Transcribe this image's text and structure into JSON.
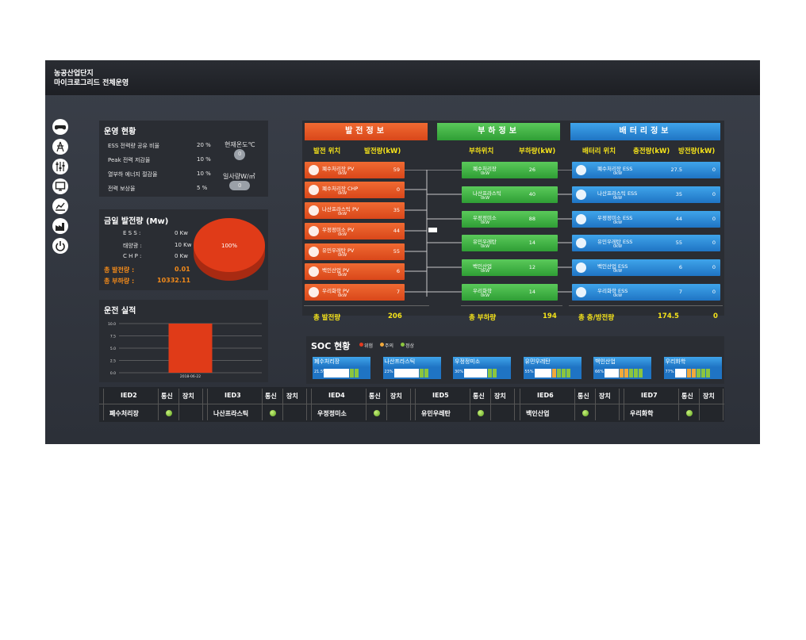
{
  "header": {
    "line1": "농공산업단지",
    "line2": "마이크로그리드 전체운영"
  },
  "sidebar_icons": [
    "gamepad-icon",
    "power-line-icon",
    "sliders-icon",
    "monitor-icon",
    "line-chart-icon",
    "factory-icon",
    "power-icon"
  ],
  "ops": {
    "title": "운영 현황",
    "rows": [
      {
        "label": "ESS 전력량 공유 비율",
        "value": "20 %"
      },
      {
        "label": "Peak 전력 저감율",
        "value": "10 %"
      },
      {
        "label": "열부하 에너지 절감율",
        "value": "10 %"
      },
      {
        "label": "전력 보상율",
        "value": "5 %"
      }
    ],
    "temp_label": "현재온도℃",
    "temp_value": "0",
    "sun_label": "일사량W/㎡",
    "sun_value": "0"
  },
  "today": {
    "title": "금일 발전량 (Mw)",
    "rows": [
      {
        "label": "E S S :",
        "value": "0 Kw"
      },
      {
        "label": "태양광 :",
        "value": "10 Kw"
      },
      {
        "label": "C H P :",
        "value": "0 Kw"
      }
    ],
    "total_gen_label": "총 발전량 :",
    "total_gen_value": "0.01",
    "total_load_label": "총 부하량 :",
    "total_load_value": "10332.11",
    "pie_label": "100%"
  },
  "perf": {
    "title": "운전 실적",
    "chart_data": {
      "type": "bar",
      "categories": [
        "2018-06-22"
      ],
      "values": [
        10.0
      ],
      "yticks": [
        "10.0",
        "7.5",
        "5.0",
        "2.5",
        "0.0"
      ],
      "ylim": [
        0,
        10
      ]
    }
  },
  "gen": {
    "header": "발전정보",
    "col1": "발전 위치",
    "col2": "발전량(kW)",
    "items": [
      {
        "name": "폐수처리장 PV",
        "sub": "0kW",
        "value": "59"
      },
      {
        "name": "폐수처리장 CHP",
        "sub": "0kW",
        "value": "0"
      },
      {
        "name": "나산프라스틱 PV",
        "sub": "0kW",
        "value": "35"
      },
      {
        "name": "우정정미소 PV",
        "sub": "0kW",
        "value": "44"
      },
      {
        "name": "유민우레탄 PV",
        "sub": "0kW",
        "value": "55"
      },
      {
        "name": "백인산업 PV",
        "sub": "0kW",
        "value": "6"
      },
      {
        "name": "우리화학 PV",
        "sub": "0kW",
        "value": "7"
      }
    ],
    "total_label": "총 발전량",
    "total_value": "206"
  },
  "load": {
    "header": "부하정보",
    "col1": "부하위치",
    "col2": "부하량(kW)",
    "items": [
      {
        "name": "폐수처리장",
        "sub": "0kW",
        "value": "26"
      },
      {
        "name": "나산프라스틱",
        "sub": "0kW",
        "value": "40"
      },
      {
        "name": "우정정미소",
        "sub": "0kW",
        "value": "88"
      },
      {
        "name": "유민우레탄",
        "sub": "0kW",
        "value": "14"
      },
      {
        "name": "백인산업",
        "sub": "0kW",
        "value": "12"
      },
      {
        "name": "우리화학",
        "sub": "0kW",
        "value": "14"
      }
    ],
    "total_label": "총 부하량",
    "total_value": "194"
  },
  "battery": {
    "header": "배터리정보",
    "col1": "배터리 위치",
    "col2": "충전량(kW)",
    "col3": "방전량(kW)",
    "items": [
      {
        "name": "폐수처리장 ESS",
        "sub": "0kW",
        "charge": "27.5",
        "discharge": "0"
      },
      {
        "name": "나산프라스틱 ESS",
        "sub": "0kW",
        "charge": "35",
        "discharge": "0"
      },
      {
        "name": "우정정미소 ESS",
        "sub": "0kW",
        "charge": "44",
        "discharge": "0"
      },
      {
        "name": "유민우레탄 ESS",
        "sub": "0kW",
        "charge": "55",
        "discharge": "0"
      },
      {
        "name": "백인산업 ESS",
        "sub": "0kW",
        "charge": "6",
        "discharge": "0"
      },
      {
        "name": "우리화학 ESS",
        "sub": "0kW",
        "charge": "7",
        "discharge": "0"
      }
    ],
    "total_label": "총 충/방전량",
    "total_charge": "174.5",
    "total_discharge": "0"
  },
  "soc": {
    "title": "SOC 현황",
    "legend": [
      {
        "label": "위험",
        "color": "#e53a1f"
      },
      {
        "label": "주의",
        "color": "#f2a93b"
      },
      {
        "label": "정상",
        "color": "#8bc53f"
      }
    ],
    "cards": [
      {
        "name": "폐수처리장",
        "pct": "21.5%",
        "level": 0.215
      },
      {
        "name": "나산프라스틱",
        "pct": "23%",
        "level": 0.23
      },
      {
        "name": "우정정미소",
        "pct": "30%",
        "level": 0.3
      },
      {
        "name": "유민우레탄",
        "pct": "55%",
        "level": 0.55
      },
      {
        "name": "백인산업",
        "pct": "66%",
        "level": 0.66
      },
      {
        "name": "우리화학",
        "pct": "77%",
        "level": 0.77
      }
    ]
  },
  "ied": {
    "comm_label": "통신",
    "device_label": "장치",
    "items": [
      {
        "id": "IED2",
        "site": "폐수처리장"
      },
      {
        "id": "IED3",
        "site": "나산프라스틱"
      },
      {
        "id": "IED4",
        "site": "우정정미소"
      },
      {
        "id": "IED5",
        "site": "유민우레탄"
      },
      {
        "id": "IED6",
        "site": "백인산업"
      },
      {
        "id": "IED7",
        "site": "우리화학"
      }
    ]
  }
}
